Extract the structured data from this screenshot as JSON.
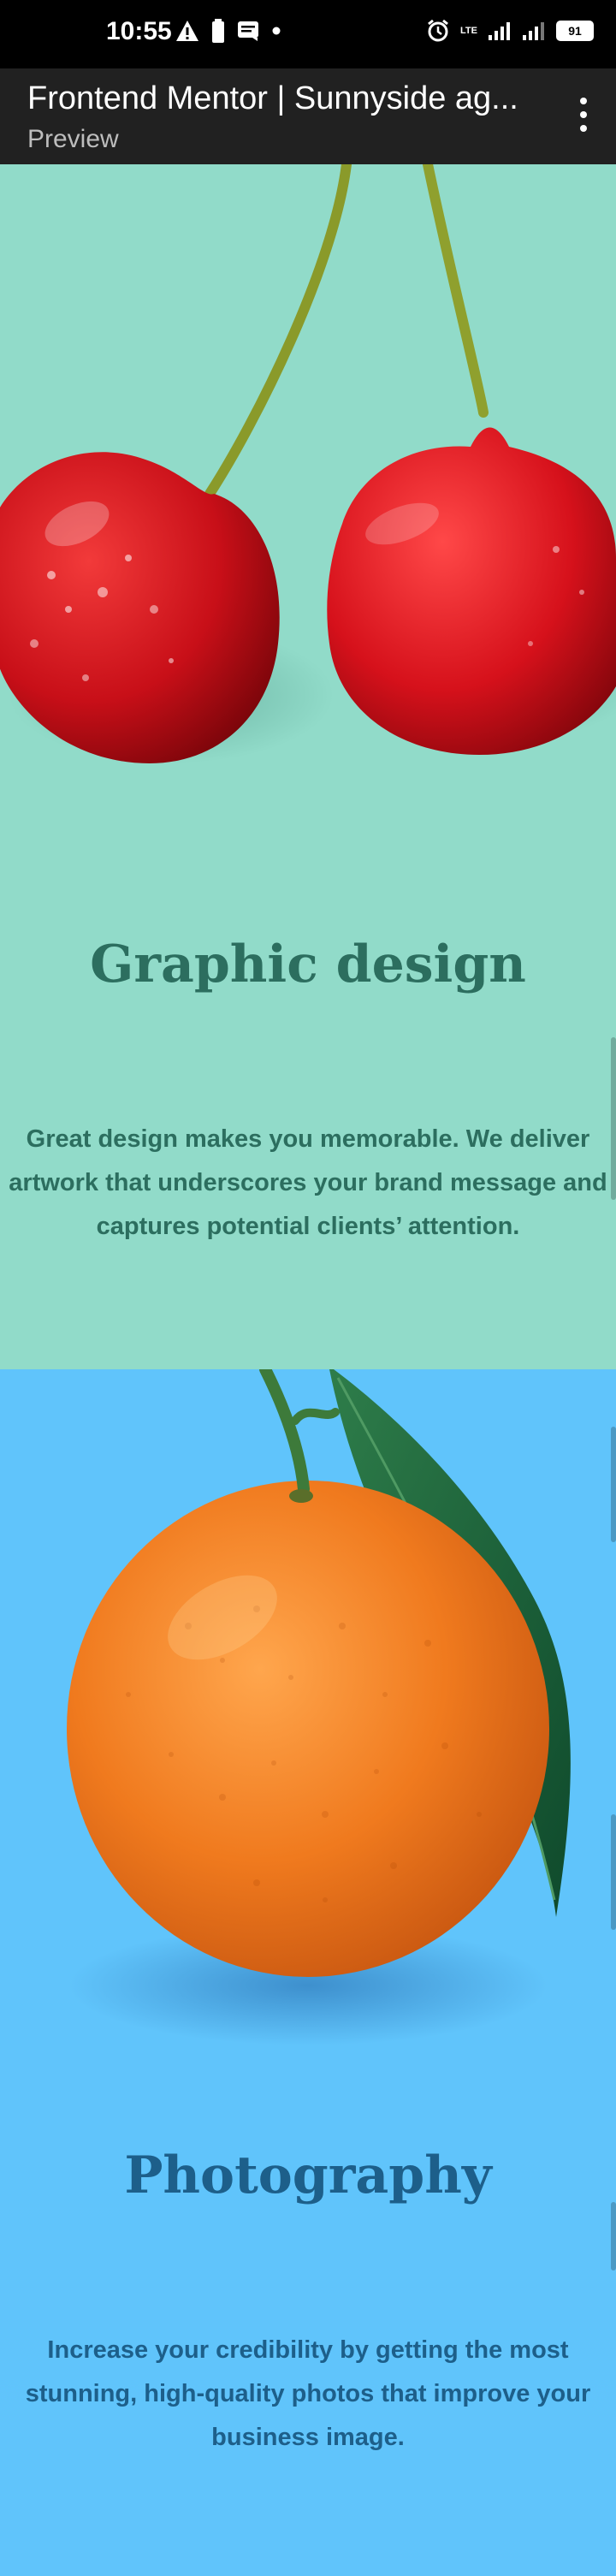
{
  "status_bar": {
    "time": "10:55",
    "battery": "91",
    "network": "LTE"
  },
  "app_bar": {
    "title": "Frontend Mentor | Sunnyside ag...",
    "subtitle": "Preview"
  },
  "sections": [
    {
      "heading": "Graphic design",
      "body": "Great design makes you memorable. We deliver artwork that underscores your brand message and captures potential clients’ attention.",
      "bg_color": "#91dbc9",
      "text_color": "#2c6e5f"
    },
    {
      "heading": "Photography",
      "body": "Increase your credibility by getting the most stunning, high-quality photos that improve your business image.",
      "bg_color": "#60c4fb",
      "text_color": "#1d5f8a"
    }
  ],
  "icons": [
    "warning-icon",
    "battery-saver-icon",
    "message-icon",
    "alarm-icon",
    "signal-icon",
    "battery-icon",
    "more-vert-icon"
  ]
}
